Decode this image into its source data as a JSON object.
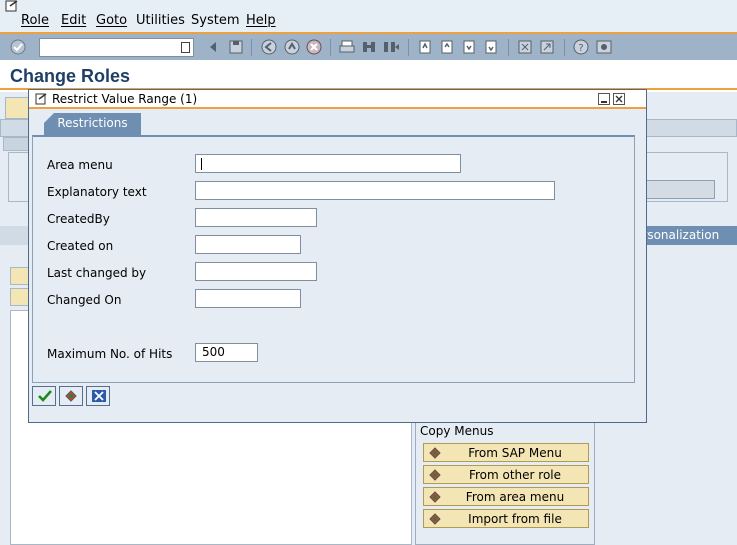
{
  "menubar": {
    "items": [
      "Role",
      "Edit",
      "Goto",
      "Utilities",
      "System",
      "Help"
    ]
  },
  "header": {
    "title": "Change Roles"
  },
  "background": {
    "tab_personalization": "ersonalization",
    "copy_menus": {
      "title": "Copy Menus",
      "buttons": [
        "From SAP Menu",
        "From other role",
        "From area menu",
        "Import from file"
      ]
    }
  },
  "dialog": {
    "title": "Restrict Value Range (1)",
    "tab": "Restrictions",
    "fields": [
      {
        "label": "Area menu",
        "value": ""
      },
      {
        "label": "Explanatory text",
        "value": ""
      },
      {
        "label": "CreatedBy",
        "value": ""
      },
      {
        "label": "Created on",
        "value": ""
      },
      {
        "label": "Last changed by",
        "value": ""
      },
      {
        "label": "Changed On",
        "value": ""
      }
    ],
    "max_hits": {
      "label": "Maximum No. of Hits",
      "value": "500"
    }
  },
  "colors": {
    "accent_orange": "#f0a03c",
    "title_blue": "#1f3f66",
    "tab_blue": "#6e8fb2"
  }
}
